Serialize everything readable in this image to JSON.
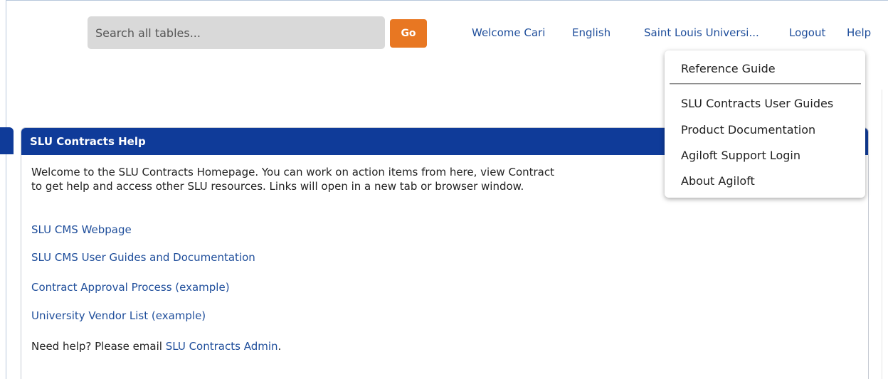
{
  "search": {
    "placeholder": "Search all tables...",
    "go_label": "Go"
  },
  "topbar": {
    "welcome": "Welcome Cari",
    "language": "English",
    "organization": "Saint Louis Universi...",
    "logout": "Logout",
    "help": "Help"
  },
  "help_menu": {
    "items": [
      "Reference Guide",
      "SLU Contracts User Guides",
      "Product Documentation",
      "Agiloft Support Login",
      "About Agiloft"
    ]
  },
  "panel": {
    "title": "SLU Contracts Help",
    "intro_line1": "Welcome to the SLU Contracts Homepage. You can work on action items from here, view Contract",
    "intro_line2": "to get help and access other SLU resources. Links will open in a new tab or browser window.",
    "links": [
      "SLU CMS Webpage",
      "SLU CMS User Guides and Documentation",
      "Contract Approval Process (example)",
      "University Vendor List (example)"
    ],
    "help_prefix": "Need help? Please email ",
    "help_link": "SLU Contracts Admin",
    "help_suffix": "."
  },
  "colors": {
    "header_blue": "#0f3b99",
    "go_orange": "#e87722",
    "link_blue": "#1f4e9b"
  }
}
